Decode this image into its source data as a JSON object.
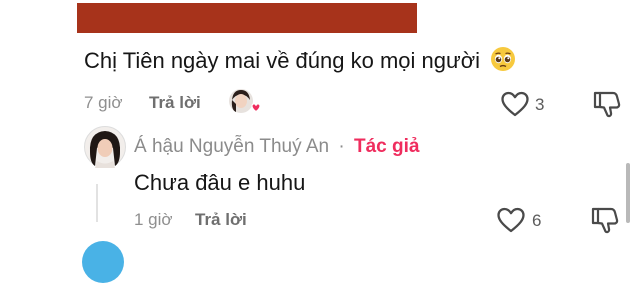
{
  "comment": {
    "text": "Chị Tiên ngày mai về đúng ko mọi người",
    "emoji_icon": "pleading-face-emoji",
    "time": "7 giờ",
    "reply_label": "Trả lời",
    "likes": "3",
    "redaction_color": "#a7331b"
  },
  "reply": {
    "author_name": "Á hậu Nguyễn Thuý An",
    "separator": "·",
    "author_tag": "Tác giả",
    "text": "Chưa đâu e huhu",
    "time": "1 giờ",
    "reply_label": "Trả lời",
    "likes": "6"
  },
  "colors": {
    "author_tag": "#ef2d5e",
    "meta_text": "#8f8f8f",
    "body_text": "#161616"
  }
}
